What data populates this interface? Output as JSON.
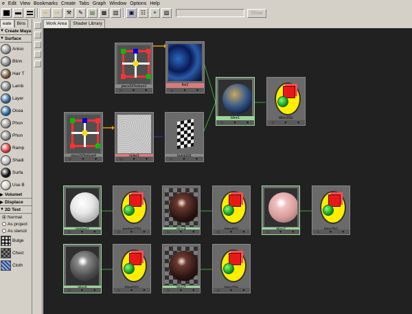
{
  "menu": [
    "e",
    "Edit",
    "View",
    "Bookmarks",
    "Create",
    "Tabs",
    "Graph",
    "Window",
    "Options",
    "Help"
  ],
  "toolbar": {
    "show_label": "Show"
  },
  "left_panel": {
    "tabs": [
      "eate",
      "Bins"
    ],
    "create_header": "Create Maya",
    "surface_header": "Surface",
    "surface_items": [
      {
        "label": "Aniso",
        "color": "#9a9a9a"
      },
      {
        "label": "Blinn",
        "color": "#8c8c8c"
      },
      {
        "label": "Hair T",
        "color": "#7a5a3a"
      },
      {
        "label": "Lamb",
        "color": "#888888"
      },
      {
        "label": "Layer",
        "color": "#3a6aa0"
      },
      {
        "label": "Ocea",
        "color": "#2a6aa8"
      },
      {
        "label": "Phon",
        "color": "#a0a0a0"
      },
      {
        "label": "Phon",
        "color": "#909090"
      },
      {
        "label": "Ramp",
        "color": "#e04040"
      },
      {
        "label": "Shadi",
        "color": "#bbbbbb"
      },
      {
        "label": "Surfa",
        "color": "#111111"
      },
      {
        "label": "Use B",
        "color": "#d4d0c8"
      }
    ],
    "volumetric_header": "Volumet",
    "displace_header": "Displace",
    "textures_header": "2D Text",
    "radio_items": [
      "Normal",
      "As project",
      "As stencil"
    ],
    "texture_items": [
      "Bulge",
      "Checl",
      "Cloth"
    ]
  },
  "tabs": [
    "Work Area",
    "Shader Library"
  ],
  "nodes": {
    "place2dTexture2": "place2dTexture2",
    "file3": "file3",
    "place2dTexture4": "place2dTexture4",
    "noise1": "noise1",
    "bump2d1": "bump2d1",
    "blinn1": "blinn1",
    "blinn1SG": "blinn1SG",
    "lambert2": "lambert2",
    "lambert2SG": "lambert2SG",
    "blinn4": "blinn4",
    "blinn4SG": "blinn4SG",
    "blinn7": "blinn7",
    "blinn7SG": "blinn7SG",
    "blinn6": "blinn6",
    "blinn6SG": "blinn6SG",
    "blinn2": "blinn2",
    "blinn2SG": "blinn2SG"
  },
  "colors": {
    "workarea_bg": "#212121",
    "node_bg": "#6a6a6a",
    "label_red": "#d67c7c",
    "label_green": "#9ad69a",
    "conn_green": "#3aa83a",
    "conn_yellow": "#e0a000",
    "conn_blue": "#3040c0"
  }
}
